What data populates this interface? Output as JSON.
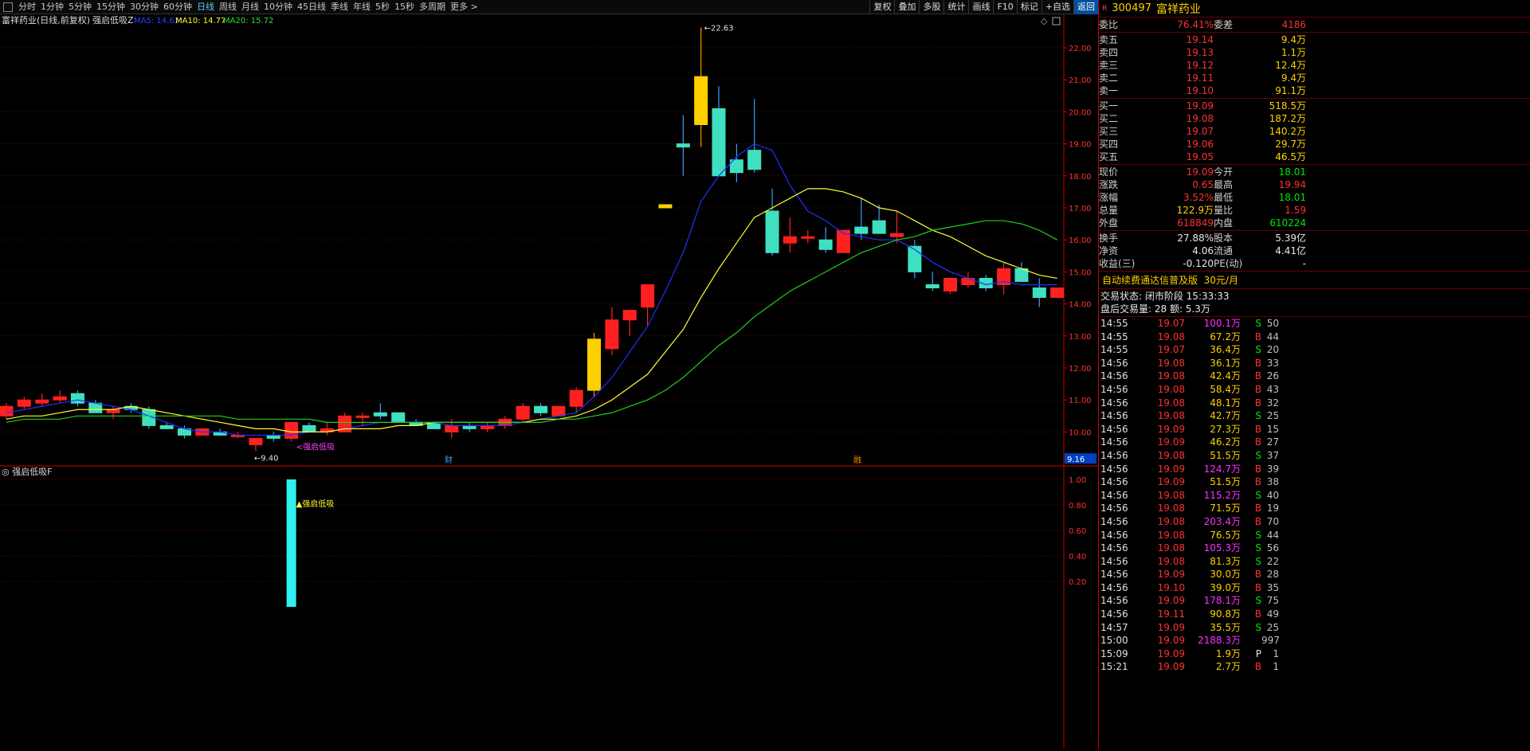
{
  "toolbar": {
    "items": [
      "分时",
      "1分钟",
      "5分钟",
      "15分钟",
      "30分钟",
      "60分钟",
      "日线",
      "周线",
      "月线",
      "10分钟",
      "45日线",
      "季线",
      "年线",
      "5秒",
      "15秒",
      "多周期",
      "更多 >"
    ],
    "active": "日线",
    "right": [
      "复权",
      "叠加",
      "多股",
      "统计",
      "画线",
      "F10",
      "标记",
      "+自选",
      "返回"
    ]
  },
  "header": {
    "title": "富祥药业(日线,前复权)",
    "indicator": "强启低吸Z",
    "ma5": "MA5: 14.63",
    "ma10": "MA10: 14.77",
    "ma20": "MA20: 15.72"
  },
  "annotations": {
    "high": "22.63",
    "low": "9.40",
    "signal": "强启低吸",
    "cai": "财",
    "rong": "融",
    "price_tag": "9.16"
  },
  "sub_chart": {
    "title": "强启低吸F",
    "signal": "强启低吸",
    "ticks": [
      "1.00",
      "0.80",
      "0.60",
      "0.40",
      "0.20"
    ]
  },
  "chart_data": {
    "type": "candlestick",
    "price_ticks": [
      "22.00",
      "21.00",
      "20.00",
      "19.00",
      "18.00",
      "17.00",
      "16.00",
      "15.00",
      "14.00",
      "13.00",
      "12.00",
      "11.00",
      "10.00"
    ],
    "ohlc": [
      [
        10.5,
        10.9,
        10.4,
        10.8
      ],
      [
        10.8,
        11.1,
        10.7,
        11.0
      ],
      [
        10.9,
        11.2,
        10.8,
        11.0
      ],
      [
        11.0,
        11.3,
        10.9,
        11.1
      ],
      [
        11.2,
        11.3,
        10.8,
        10.9
      ],
      [
        10.9,
        11.0,
        10.6,
        10.6
      ],
      [
        10.6,
        10.8,
        10.4,
        10.7
      ],
      [
        10.8,
        10.9,
        10.6,
        10.7
      ],
      [
        10.7,
        10.8,
        10.1,
        10.2
      ],
      [
        10.2,
        10.3,
        10.1,
        10.1
      ],
      [
        10.1,
        10.2,
        9.8,
        9.9
      ],
      [
        9.9,
        10.1,
        9.9,
        10.1
      ],
      [
        10.0,
        10.1,
        9.9,
        9.9
      ],
      [
        9.9,
        10.0,
        9.8,
        9.9
      ],
      [
        9.6,
        9.8,
        9.4,
        9.8
      ],
      [
        9.9,
        10.0,
        9.7,
        9.8
      ],
      [
        9.8,
        10.3,
        9.7,
        10.3
      ],
      [
        10.2,
        10.3,
        10.0,
        10.0
      ],
      [
        10.0,
        10.3,
        9.9,
        10.1
      ],
      [
        10.0,
        10.6,
        10.0,
        10.5
      ],
      [
        10.5,
        10.6,
        10.2,
        10.5
      ],
      [
        10.6,
        10.9,
        10.4,
        10.5
      ],
      [
        10.6,
        10.6,
        10.3,
        10.3
      ],
      [
        10.3,
        10.4,
        10.2,
        10.2
      ],
      [
        10.3,
        10.3,
        10.1,
        10.1
      ],
      [
        10.0,
        10.4,
        9.8,
        10.2
      ],
      [
        10.2,
        10.3,
        10.0,
        10.1
      ],
      [
        10.1,
        10.3,
        10.0,
        10.2
      ],
      [
        10.2,
        10.5,
        10.1,
        10.4
      ],
      [
        10.4,
        10.9,
        10.3,
        10.8
      ],
      [
        10.8,
        10.9,
        10.5,
        10.6
      ],
      [
        10.5,
        10.8,
        10.5,
        10.8
      ],
      [
        10.8,
        11.4,
        10.6,
        11.3
      ],
      [
        11.3,
        13.1,
        11.1,
        12.9
      ],
      [
        12.6,
        13.9,
        12.4,
        13.5
      ],
      [
        13.5,
        13.8,
        13.0,
        13.8
      ],
      [
        13.9,
        14.5,
        13.3,
        14.6
      ],
      [
        17.0,
        17.0,
        17.1,
        17.1
      ],
      [
        19.0,
        19.9,
        18.0,
        18.9
      ],
      [
        19.6,
        22.63,
        18.9,
        21.1
      ],
      [
        20.1,
        20.8,
        18.0,
        18.0
      ],
      [
        18.5,
        19.0,
        17.8,
        18.1
      ],
      [
        18.8,
        20.4,
        18.1,
        18.2
      ],
      [
        16.9,
        17.6,
        15.5,
        15.6
      ],
      [
        15.9,
        16.7,
        15.6,
        16.1
      ],
      [
        16.1,
        16.3,
        15.9,
        16.1
      ],
      [
        16.0,
        16.4,
        15.6,
        15.7
      ],
      [
        15.6,
        16.3,
        15.6,
        16.3
      ],
      [
        16.4,
        17.3,
        16.0,
        16.2
      ],
      [
        16.6,
        17.1,
        16.2,
        16.2
      ],
      [
        16.1,
        16.9,
        15.9,
        16.2
      ],
      [
        15.8,
        16.0,
        14.8,
        15.0
      ],
      [
        14.6,
        15.0,
        14.4,
        14.5
      ],
      [
        14.4,
        14.8,
        14.3,
        14.8
      ],
      [
        14.6,
        15.0,
        14.5,
        14.8
      ],
      [
        14.8,
        14.9,
        14.4,
        14.5
      ],
      [
        14.6,
        15.3,
        14.3,
        15.1
      ],
      [
        15.1,
        15.3,
        14.7,
        14.7
      ],
      [
        14.5,
        14.8,
        13.9,
        14.2
      ],
      [
        14.2,
        14.5,
        14.2,
        14.5
      ]
    ],
    "ma5": [
      10.6,
      10.7,
      10.8,
      10.9,
      11.0,
      10.9,
      10.8,
      10.7,
      10.5,
      10.3,
      10.1,
      10.0,
      10.0,
      9.9,
      9.9,
      9.9,
      9.9,
      10.0,
      10.0,
      10.1,
      10.2,
      10.3,
      10.3,
      10.3,
      10.3,
      10.2,
      10.2,
      10.2,
      10.2,
      10.3,
      10.4,
      10.5,
      10.6,
      11.1,
      11.7,
      12.5,
      13.3,
      14.4,
      15.6,
      17.2,
      18.0,
      18.6,
      19.0,
      18.8,
      17.7,
      16.9,
      16.6,
      16.2,
      16.1,
      16.0,
      16.0,
      15.7,
      15.3,
      15.0,
      14.8,
      14.6,
      14.7,
      14.6,
      14.6,
      14.6
    ],
    "ma10": [
      10.4,
      10.5,
      10.5,
      10.6,
      10.7,
      10.7,
      10.7,
      10.8,
      10.7,
      10.6,
      10.5,
      10.4,
      10.3,
      10.2,
      10.1,
      10.1,
      10.0,
      10.0,
      10.0,
      10.1,
      10.1,
      10.1,
      10.2,
      10.2,
      10.3,
      10.3,
      10.3,
      10.3,
      10.3,
      10.3,
      10.4,
      10.4,
      10.5,
      10.7,
      11.0,
      11.4,
      11.8,
      12.5,
      13.2,
      14.2,
      15.1,
      15.9,
      16.7,
      17.0,
      17.3,
      17.6,
      17.6,
      17.5,
      17.3,
      17.0,
      16.9,
      16.6,
      16.3,
      16.1,
      15.8,
      15.5,
      15.3,
      15.1,
      14.9,
      14.8
    ],
    "ma20": [
      10.3,
      10.4,
      10.4,
      10.4,
      10.5,
      10.5,
      10.5,
      10.5,
      10.5,
      10.5,
      10.5,
      10.5,
      10.5,
      10.4,
      10.4,
      10.4,
      10.4,
      10.4,
      10.3,
      10.3,
      10.3,
      10.3,
      10.3,
      10.3,
      10.3,
      10.3,
      10.3,
      10.3,
      10.3,
      10.3,
      10.3,
      10.4,
      10.4,
      10.5,
      10.6,
      10.8,
      11.0,
      11.3,
      11.7,
      12.2,
      12.7,
      13.1,
      13.6,
      14.0,
      14.4,
      14.7,
      15.0,
      15.3,
      15.6,
      15.8,
      16.0,
      16.1,
      16.3,
      16.4,
      16.5,
      16.6,
      16.6,
      16.5,
      16.3,
      16.0
    ],
    "signal_bar_index": 16,
    "signal_value": 1.0
  },
  "quote": {
    "code": "300497",
    "name": "富祥药业",
    "weibi": {
      "label": "委比",
      "value": "76.41%",
      "label2": "委差",
      "value2": "4186"
    },
    "sells": [
      {
        "label": "卖五",
        "price": "19.14",
        "vol": "9.4万"
      },
      {
        "label": "卖四",
        "price": "19.13",
        "vol": "1.1万"
      },
      {
        "label": "卖三",
        "price": "19.12",
        "vol": "12.4万"
      },
      {
        "label": "卖二",
        "price": "19.11",
        "vol": "9.4万"
      },
      {
        "label": "卖一",
        "price": "19.10",
        "vol": "91.1万"
      }
    ],
    "buys": [
      {
        "label": "买一",
        "price": "19.09",
        "vol": "518.5万"
      },
      {
        "label": "买二",
        "price": "19.08",
        "vol": "187.2万"
      },
      {
        "label": "买三",
        "price": "19.07",
        "vol": "140.2万"
      },
      {
        "label": "买四",
        "price": "19.06",
        "vol": "29.7万"
      },
      {
        "label": "买五",
        "price": "19.05",
        "vol": "46.5万"
      }
    ],
    "stats1": [
      {
        "l1": "现价",
        "v1": "19.09",
        "c1": "red",
        "l2": "今开",
        "v2": "18.01",
        "c2": "green"
      },
      {
        "l1": "涨跌",
        "v1": "0.65",
        "c1": "red",
        "l2": "最高",
        "v2": "19.94",
        "c2": "red"
      },
      {
        "l1": "涨幅",
        "v1": "3.52%",
        "c1": "red",
        "l2": "最低",
        "v2": "18.01",
        "c2": "green"
      },
      {
        "l1": "总量",
        "v1": "122.9万",
        "c1": "yellow",
        "l2": "量比",
        "v2": "1.59",
        "c2": "red"
      },
      {
        "l1": "外盘",
        "v1": "618849",
        "c1": "red",
        "l2": "内盘",
        "v2": "610224",
        "c2": "green"
      }
    ],
    "stats2": [
      {
        "l1": "换手",
        "v1": "27.88%",
        "c1": "white",
        "l2": "股本",
        "v2": "5.39亿",
        "c2": "white"
      },
      {
        "l1": "净资",
        "v1": "4.06",
        "c1": "white",
        "l2": "流通",
        "v2": "4.41亿",
        "c2": "white"
      },
      {
        "l1": "收益(三)",
        "v1": "-0.120",
        "c1": "white",
        "l2": "PE(动)",
        "v2": "-",
        "c2": "white"
      }
    ],
    "ad": {
      "text": "自动续费通达信普及版",
      "price": "30元/月"
    },
    "trade_state": "交易状态: 闭市阶段 15:33:33",
    "after_hours": "盘后交易量: 28  额: 5.3万"
  },
  "ticks": [
    [
      "14:55",
      "19.07",
      "100.1万",
      "S",
      "50",
      "mag"
    ],
    [
      "14:55",
      "19.08",
      "67.2万",
      "B",
      "44",
      "yellow"
    ],
    [
      "14:55",
      "19.07",
      "36.4万",
      "S",
      "20",
      "yellow"
    ],
    [
      "14:56",
      "19.08",
      "36.1万",
      "B",
      "33",
      "yellow"
    ],
    [
      "14:56",
      "19.08",
      "42.4万",
      "B",
      "26",
      "yellow"
    ],
    [
      "14:56",
      "19.08",
      "58.4万",
      "B",
      "43",
      "yellow"
    ],
    [
      "14:56",
      "19.08",
      "48.1万",
      "B",
      "32",
      "yellow"
    ],
    [
      "14:56",
      "19.08",
      "42.7万",
      "S",
      "25",
      "yellow"
    ],
    [
      "14:56",
      "19.09",
      "27.3万",
      "B",
      "15",
      "yellow"
    ],
    [
      "14:56",
      "19.09",
      "46.2万",
      "B",
      "27",
      "yellow"
    ],
    [
      "14:56",
      "19.08",
      "51.5万",
      "S",
      "37",
      "yellow"
    ],
    [
      "14:56",
      "19.09",
      "124.7万",
      "B",
      "39",
      "mag"
    ],
    [
      "14:56",
      "19.09",
      "51.5万",
      "B",
      "38",
      "yellow"
    ],
    [
      "14:56",
      "19.08",
      "115.2万",
      "S",
      "40",
      "mag"
    ],
    [
      "14:56",
      "19.08",
      "71.5万",
      "B",
      "19",
      "yellow"
    ],
    [
      "14:56",
      "19.08",
      "203.4万",
      "B",
      "70",
      "mag"
    ],
    [
      "14:56",
      "19.08",
      "76.5万",
      "S",
      "44",
      "yellow"
    ],
    [
      "14:56",
      "19.08",
      "105.3万",
      "S",
      "56",
      "mag"
    ],
    [
      "14:56",
      "19.08",
      "81.3万",
      "S",
      "22",
      "yellow"
    ],
    [
      "14:56",
      "19.09",
      "30.0万",
      "B",
      "28",
      "yellow"
    ],
    [
      "14:56",
      "19.10",
      "39.0万",
      "B",
      "35",
      "yellow"
    ],
    [
      "14:56",
      "19.09",
      "178.1万",
      "S",
      "75",
      "mag"
    ],
    [
      "14:56",
      "19.11",
      "90.8万",
      "B",
      "49",
      "yellow"
    ],
    [
      "14:57",
      "19.09",
      "35.5万",
      "S",
      "25",
      "yellow"
    ],
    [
      "15:00",
      "19.09",
      "2188.3万",
      "",
      "997",
      "mag"
    ],
    [
      "15:09",
      "19.09",
      "1.9万",
      "P",
      "1",
      "yellow"
    ],
    [
      "15:21",
      "19.09",
      "2.7万",
      "B",
      "1",
      "yellow"
    ]
  ]
}
